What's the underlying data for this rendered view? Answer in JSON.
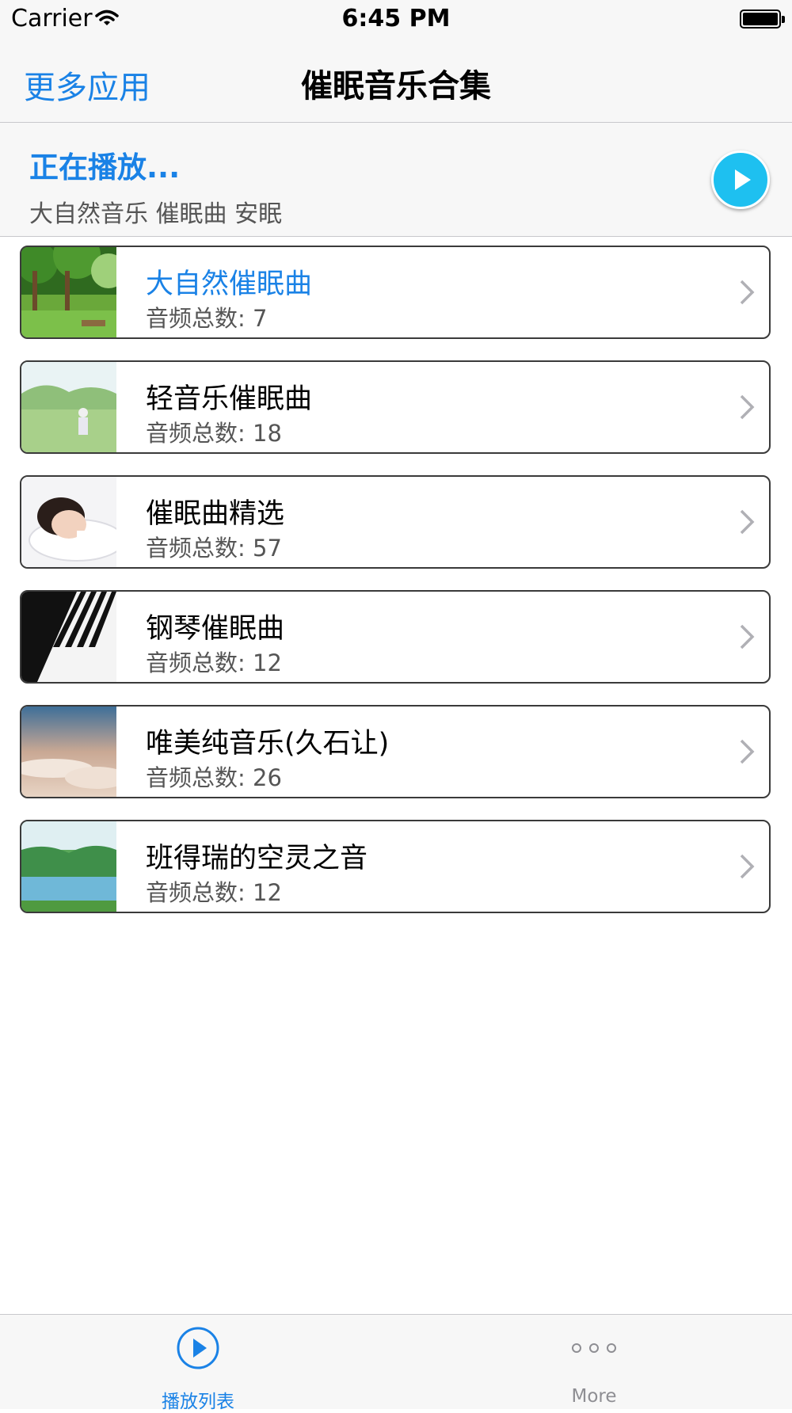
{
  "status_bar": {
    "carrier": "Carrier",
    "time": "6:45 PM"
  },
  "nav": {
    "left_button": "更多应用",
    "title": "催眠音乐合集"
  },
  "now_playing": {
    "label": "正在播放...",
    "track": "大自然音乐 催眠曲 安眠",
    "play_icon": "play-circle-icon"
  },
  "playlists": [
    {
      "title": "大自然催眠曲",
      "count_label": "音频总数: ",
      "count": "7",
      "selected": true
    },
    {
      "title": "轻音乐催眠曲",
      "count_label": "音频总数: ",
      "count": "18",
      "selected": false
    },
    {
      "title": "催眠曲精选",
      "count_label": "音频总数: ",
      "count": "57",
      "selected": false
    },
    {
      "title": "钢琴催眠曲",
      "count_label": "音频总数: ",
      "count": "12",
      "selected": false
    },
    {
      "title": "唯美纯音乐(久石让)",
      "count_label": "音频总数: ",
      "count": "26",
      "selected": false
    },
    {
      "title": "班得瑞的空灵之音",
      "count_label": "音频总数: ",
      "count": "12",
      "selected": false
    }
  ],
  "tabs": [
    {
      "label": "播放列表",
      "icon": "play-circle-icon",
      "active": true
    },
    {
      "label": "More",
      "icon": "more-dots-icon",
      "active": false
    }
  ],
  "colors": {
    "accent": "#1a82e6",
    "play_button": "#1ec0f0",
    "inactive_tab": "#8e8e93"
  }
}
